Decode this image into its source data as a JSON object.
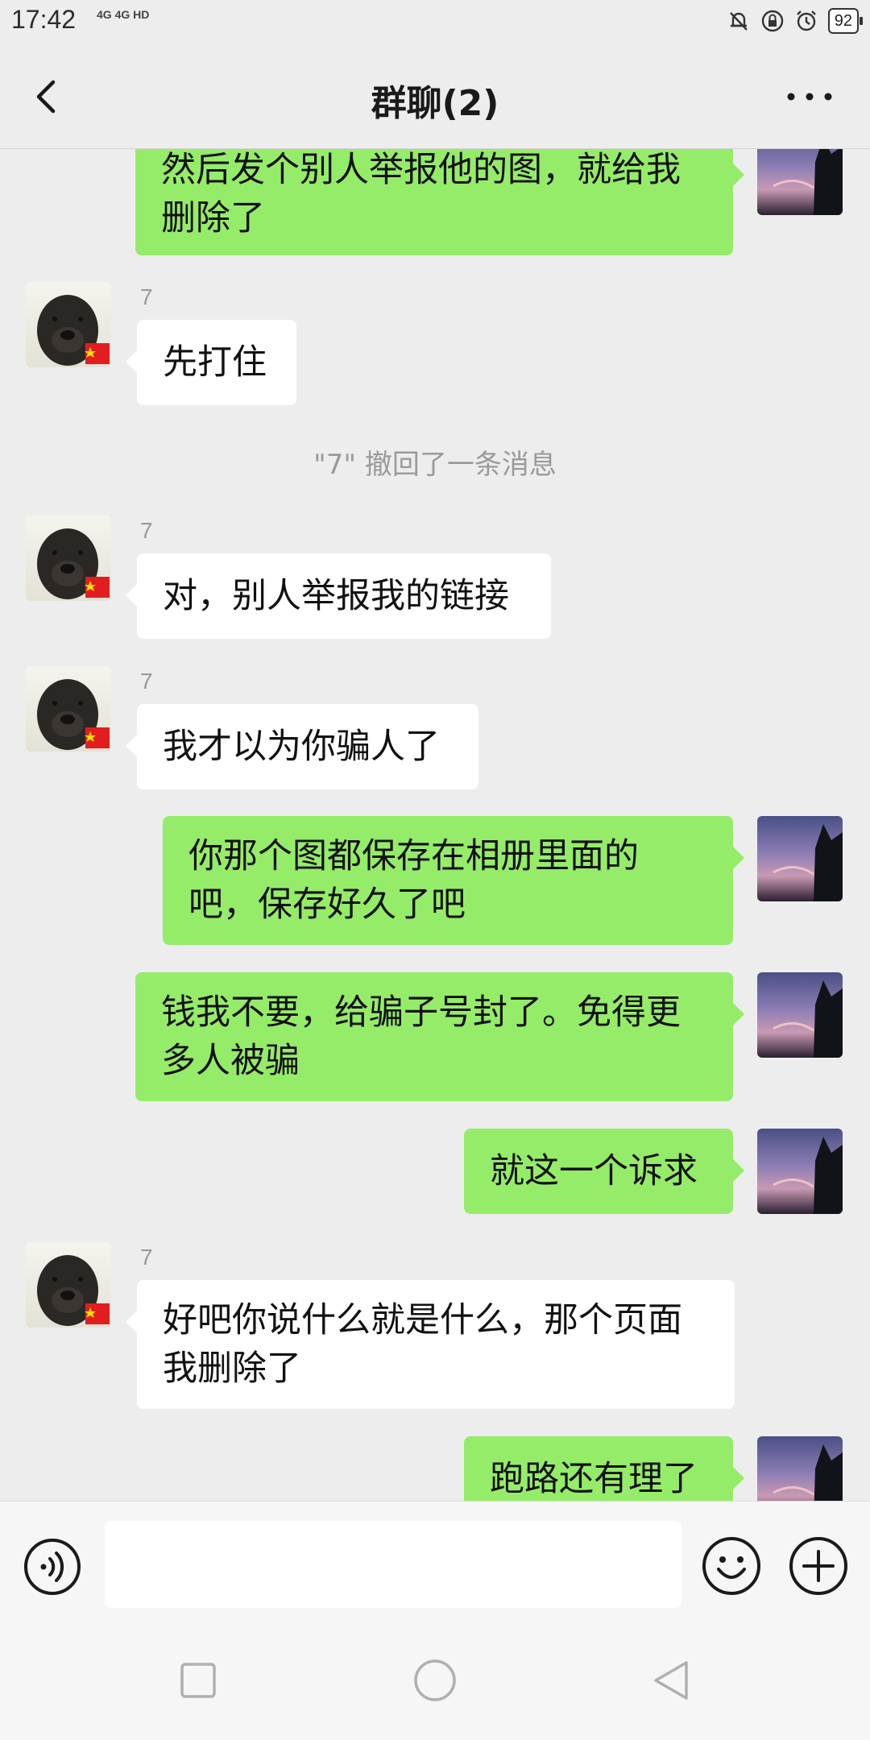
{
  "status_bar": {
    "time": "17:42",
    "network": "4G 4G HD",
    "battery": "92"
  },
  "header": {
    "title": "群聊(2)"
  },
  "messages": [
    {
      "side": "right",
      "text": "然后发个别人举报他的图，就给我删除了"
    },
    {
      "side": "left",
      "sender": "7",
      "text": "先打住"
    },
    {
      "type": "system",
      "text": "\"7\" 撤回了一条消息"
    },
    {
      "side": "left",
      "sender": "7",
      "text": "对，别人举报我的链接"
    },
    {
      "side": "left",
      "sender": "7",
      "text": "我才以为你骗人了"
    },
    {
      "side": "right",
      "text": "你那个图都保存在相册里面的吧，保存好久了吧"
    },
    {
      "side": "right",
      "text": "钱我不要，给骗子号封了。免得更多人被骗"
    },
    {
      "side": "right",
      "text": "就这一个诉求"
    },
    {
      "side": "left",
      "sender": "7",
      "text": "好吧你说什么就是什么，那个页面我删除了"
    },
    {
      "side": "right",
      "text": "跑路还有理了"
    }
  ],
  "input": {
    "value": "",
    "placeholder": ""
  },
  "icons": {
    "back": "chevron-left-icon",
    "more": "more-dots-icon",
    "voice": "voice-icon",
    "emoji": "emoji-icon",
    "plus": "plus-icon"
  },
  "colors": {
    "outgoing_bubble": "#95ec69",
    "incoming_bubble": "#ffffff",
    "background": "#ededed"
  }
}
